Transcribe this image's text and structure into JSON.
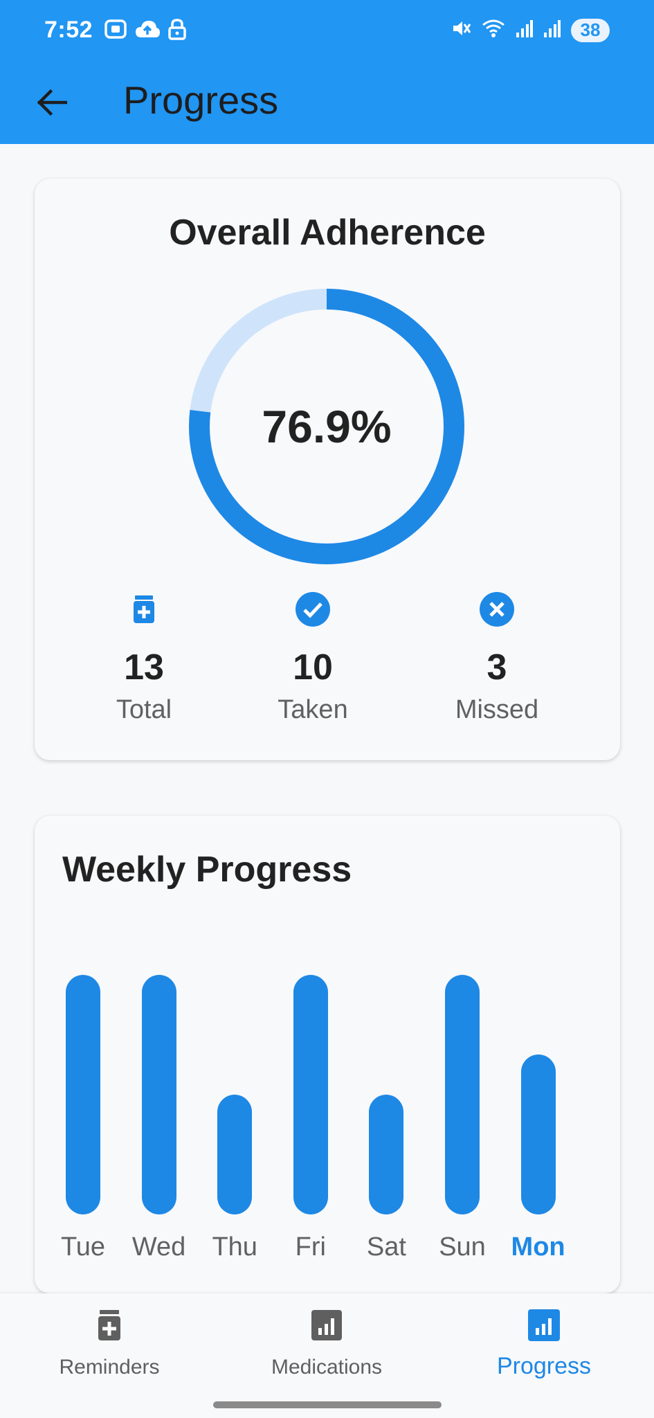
{
  "status_bar": {
    "time": "7:52",
    "battery": "38",
    "left_icons": [
      "screenshot-icon",
      "cloud-upload-icon",
      "lock-icon"
    ],
    "right_icons": [
      "mute-icon",
      "wifi-icon",
      "signal-icon",
      "signal-icon",
      "battery-icon"
    ]
  },
  "app_bar": {
    "title": "Progress",
    "back_icon": "arrow-back-icon"
  },
  "adherence": {
    "title": "Overall Adherence",
    "percent_label": "76.9%",
    "percent_value": 76.9,
    "stats": [
      {
        "icon": "medication-icon",
        "value": "13",
        "label": "Total"
      },
      {
        "icon": "check-circle-icon",
        "value": "10",
        "label": "Taken"
      },
      {
        "icon": "cancel-circle-icon",
        "value": "3",
        "label": "Missed"
      }
    ]
  },
  "weekly": {
    "title": "Weekly Progress"
  },
  "chart_data": {
    "type": "bar",
    "title": "Weekly Progress",
    "categories": [
      "Tue",
      "Wed",
      "Thu",
      "Fri",
      "Sat",
      "Sun",
      "Mon"
    ],
    "values": [
      100,
      100,
      50,
      100,
      50,
      100,
      66.7
    ],
    "ylim": [
      0,
      100
    ],
    "highlighted_category": "Mon",
    "grid": false,
    "color": "#1e88e5"
  },
  "bottom_nav": {
    "items": [
      {
        "label": "Reminders",
        "icon": "medication-icon",
        "active": false
      },
      {
        "label": "Medications",
        "icon": "bar-chart-icon",
        "active": false
      },
      {
        "label": "Progress",
        "icon": "bar-chart-icon",
        "active": true
      }
    ]
  },
  "colors": {
    "primary": "#2196f3",
    "accent": "#1e88e5",
    "ring_track": "#cfe4fa",
    "inactive_nav": "#5f5f5f"
  }
}
